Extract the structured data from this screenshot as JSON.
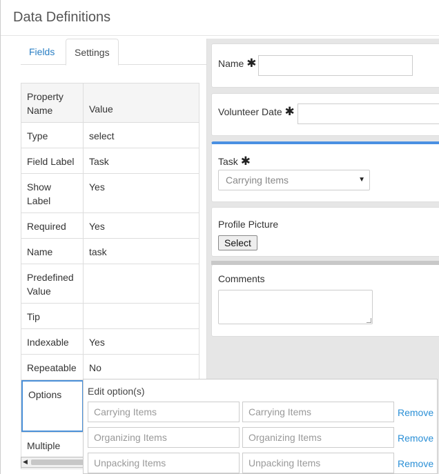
{
  "dialog": {
    "title": "Data Definitions"
  },
  "tabs": {
    "fields": "Fields",
    "settings": "Settings"
  },
  "properties": {
    "header": {
      "name": "Property Name",
      "value": "Value"
    },
    "rows": [
      {
        "name": "Type",
        "value": "select"
      },
      {
        "name": "Field Label",
        "value": "Task"
      },
      {
        "name": "Show Label",
        "value": "Yes"
      },
      {
        "name": "Required",
        "value": "Yes"
      },
      {
        "name": "Name",
        "value": "task"
      },
      {
        "name": "Predefined Value",
        "value": ""
      },
      {
        "name": "Tip",
        "value": ""
      },
      {
        "name": "Indexable",
        "value": "Yes"
      },
      {
        "name": "Repeatable",
        "value": "No"
      },
      {
        "name": "Options",
        "value": ""
      },
      {
        "name": "Multiple",
        "value": ""
      }
    ]
  },
  "form": {
    "name_label": "Name",
    "volunteer_date_label": "Volunteer Date",
    "task_label": "Task",
    "task_selected": "Carrying Items",
    "profile_picture_label": "Profile Picture",
    "select_button": "Select",
    "comments_label": "Comments",
    "required_mark": "✱"
  },
  "options_editor": {
    "title": "Edit option(s)",
    "remove_label": "Remove",
    "options": [
      {
        "label": "Carrying Items",
        "value": "Carrying Items"
      },
      {
        "label": "Organizing Items",
        "value": "Organizing Items"
      },
      {
        "label": "Unpacking Items",
        "value": "Unpacking Items"
      }
    ]
  },
  "colors": {
    "accent": "#4a90e2",
    "link": "#2a8fd6"
  }
}
